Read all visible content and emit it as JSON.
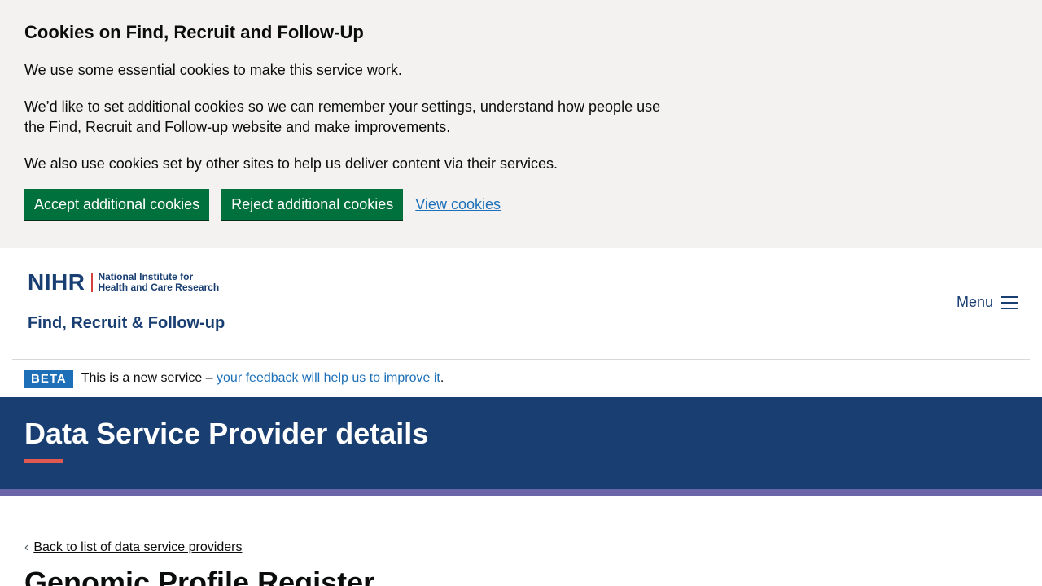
{
  "cookie_banner": {
    "title": "Cookies on Find, Recruit and Follow-Up",
    "para1": "We use some essential cookies to make this service work.",
    "para2": "We’d like to set additional cookies so we can remember your settings, understand how people use the Find, Recruit and Follow-up website and make improvements.",
    "para3": "We also use cookies set by other sites to help us deliver content via their services.",
    "accept_label": "Accept additional cookies",
    "reject_label": "Reject additional cookies",
    "view_label": "View cookies"
  },
  "header": {
    "logo_word": "NIHR",
    "logo_line1": "National Institute for",
    "logo_line2": "Health and Care Research",
    "service_name": "Find, Recruit & Follow-up",
    "menu_label": "Menu"
  },
  "beta": {
    "tag": "BETA",
    "text": "This is a new service –",
    "link": "your feedback will help us to improve it",
    "suffix": "."
  },
  "title_band": {
    "title": "Data Service Provider details"
  },
  "main": {
    "back_link": "Back to list of data service providers",
    "record_title": "Genomic Profile Register"
  },
  "colors": {
    "brand_navy": "#193e72",
    "button_green": "#00703c",
    "link_blue": "#1d70b8",
    "accent_red": "#e05a52",
    "stripe_purple": "#6b65a9"
  },
  "icons": {
    "menu": "hamburger-icon",
    "back": "chevron-left-icon"
  }
}
